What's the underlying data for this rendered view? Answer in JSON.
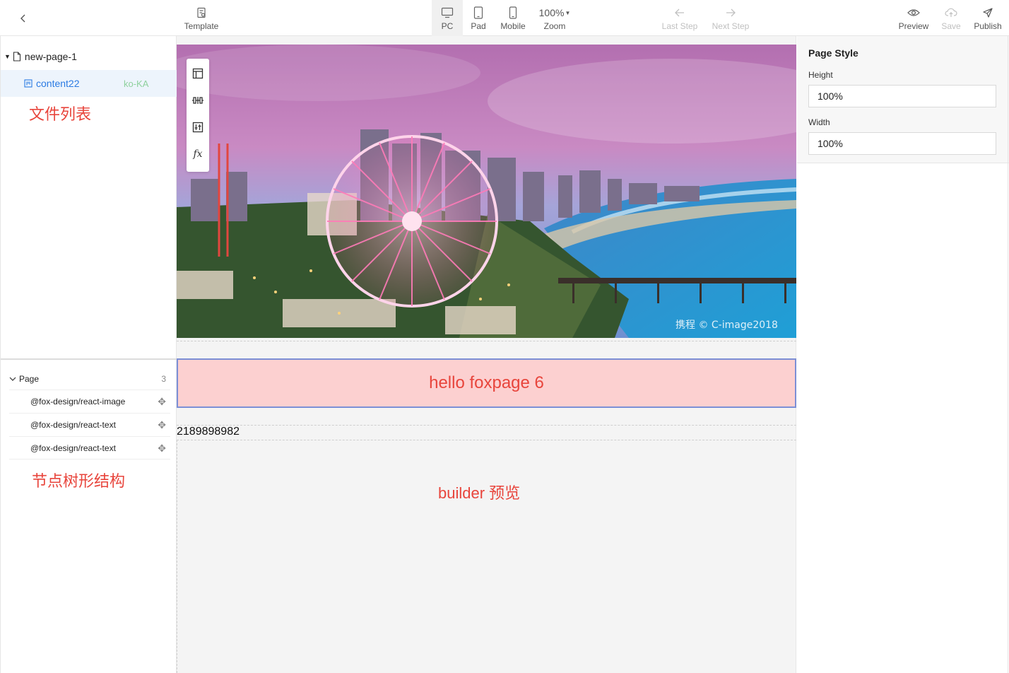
{
  "toolbar": {
    "template_label": "Template",
    "pc_label": "PC",
    "pad_label": "Pad",
    "mobile_label": "Mobile",
    "zoom_value": "100%",
    "zoom_label": "Zoom",
    "last_step_label": "Last Step",
    "next_step_label": "Next Step",
    "preview_label": "Preview",
    "save_label": "Save",
    "publish_label": "Publish"
  },
  "files": {
    "root_name": "new-page-1",
    "child_name": "content22",
    "child_locale": "ko-KA",
    "annotation": "文件列表"
  },
  "tree": {
    "root_label": "Page",
    "root_count": "3",
    "items": [
      {
        "label": "@fox-design/react-image"
      },
      {
        "label": "@fox-design/react-text"
      },
      {
        "label": "@fox-design/react-text"
      }
    ],
    "annotation": "节点树形结构"
  },
  "canvas": {
    "watermark": "携程 © C-image2018",
    "hello_text": "hello foxpage 6",
    "number_text": "2189898982",
    "annotation": "builder 预览"
  },
  "page_style": {
    "title": "Page Style",
    "height_label": "Height",
    "height_value": "100%",
    "width_label": "Width",
    "width_value": "100%"
  },
  "colors": {
    "accent_blue": "#2b7be3",
    "annotation_red": "#e8453c",
    "highlight_bg": "#fcd0d0",
    "selection_border": "#7c8fd6"
  }
}
